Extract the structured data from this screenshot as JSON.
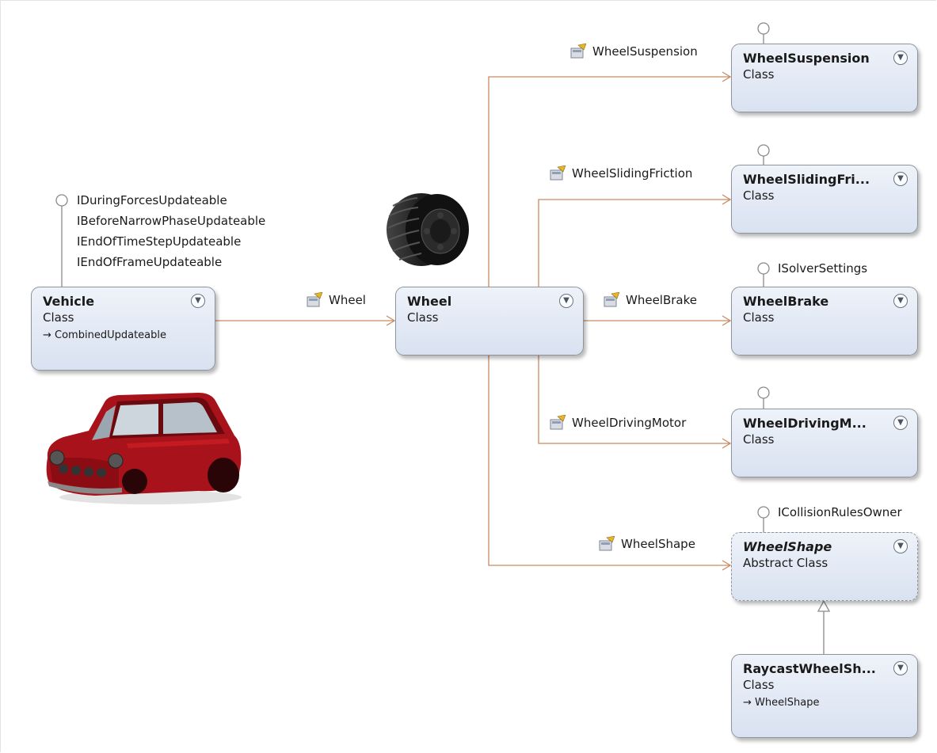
{
  "classes": {
    "vehicle": {
      "name": "Vehicle",
      "kind": "Class",
      "inherits": "CombinedUpdateable"
    },
    "wheel": {
      "name": "Wheel",
      "kind": "Class"
    },
    "wheel_suspension": {
      "name": "WheelSuspension",
      "kind": "Class"
    },
    "wheel_sliding_friction": {
      "name": "WheelSlidingFri...",
      "kind": "Class"
    },
    "wheel_brake": {
      "name": "WheelBrake",
      "kind": "Class"
    },
    "wheel_driving_motor": {
      "name": "WheelDrivingM...",
      "kind": "Class"
    },
    "wheel_shape": {
      "name": "WheelShape",
      "kind": "Abstract Class"
    },
    "raycast_wheel_shape": {
      "name": "RaycastWheelSh...",
      "kind": "Class",
      "inherits": "WheelShape"
    }
  },
  "vehicle_interfaces": [
    "IDuringForcesUpdateable",
    "IBeforeNarrowPhaseUpdateable",
    "IEndOfTimeStepUpdateable",
    "IEndOfFrameUpdateable"
  ],
  "interfaces": {
    "wheel_brake": "ISolverSettings",
    "wheel_shape": "ICollisionRulesOwner"
  },
  "associations": {
    "vehicle_wheel": "Wheel",
    "suspension": "WheelSuspension",
    "sliding_friction": "WheelSlidingFriction",
    "brake": "WheelBrake",
    "driving_motor": "WheelDrivingMotor",
    "shape": "WheelShape"
  },
  "icons": {
    "toggle": "chevron-double-down-icon",
    "property": "property-icon",
    "interface": "lollipop-interface-icon",
    "inheritance": "inherit-arrow-icon"
  },
  "colors": {
    "association_line": "#c98a62",
    "inheritance_line": "#8a8a8a",
    "box_fill_top": "#eef2f9",
    "box_fill_bottom": "#d9e2f1",
    "car_body": "#a8121a"
  }
}
